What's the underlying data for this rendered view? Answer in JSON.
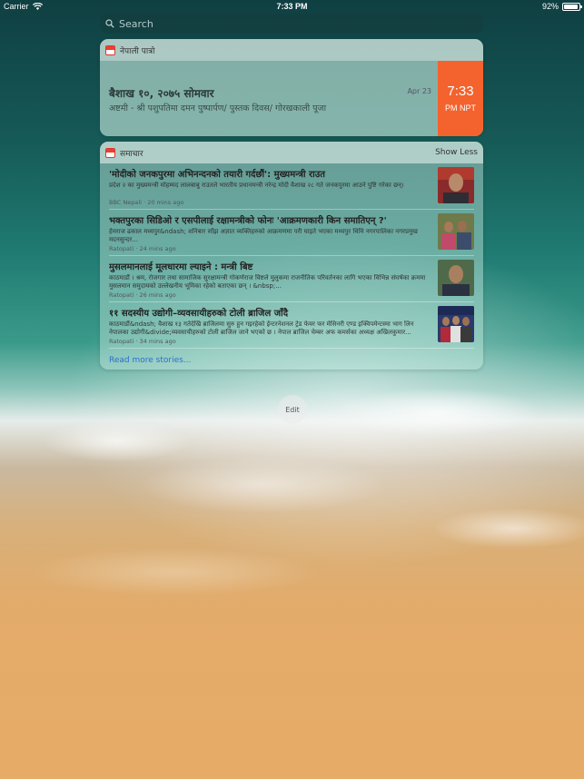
{
  "status_bar": {
    "carrier": "Carrier",
    "time": "7:33 PM",
    "battery": "92%",
    "battery_level": 0.92
  },
  "search": {
    "placeholder": "Search",
    "icon": "search-icon"
  },
  "calendar_widget": {
    "app_name": "नेपाली पात्रो",
    "title": "बैशाख १०, २०७५ सोमवार",
    "subtitle": "अष्टमी - श्री पशुपतिमा दमन पुष्पार्पण/ पुस्तक दिवस/ गोरखकाली पूजा",
    "date": "Apr 23",
    "time": "7:33",
    "time_zone": "PM NPT",
    "accent_color": "#f4622d"
  },
  "news_widget": {
    "app_name": "समाचार",
    "show_less": "Show Less",
    "items": [
      {
        "title": "'मोदीको जनकपुरमा अभिनन्दनको तयारी गर्दछौं': मुख्यमन्त्री राउत",
        "excerpt": "प्रदेश २ का मुख्यमन्त्री मोहम्मद लालबाबु राउतले भारतीय प्रधानमन्त्री नरेन्द्र मोदी वैशाख २८ गते जनकपुरमा आउने पुष्टि गरेका छन्।",
        "meta": "BBC Nepali · 20 mins ago"
      },
      {
        "title": "भक्तपुरका सिडिओ र एसपीलाई रक्षामन्त्रीको फोनः 'आक्रमणकारी किन समातिएन् ?'",
        "excerpt": "हेमराज ढकाल मध्यपुर&ndash; शनिबार साँझ अज्ञात व्यक्तिहरुको आक्रमणमा परी घाइते भएका मध्यपुर थिमि नगरपालिका नगरप्रमुख मदनसुन्दर...",
        "meta": "Ratopati · 24 mins ago"
      },
      {
        "title": "मुसलमानलाई मूलधारमा ल्याइने : मन्त्री बिष्ट",
        "excerpt": "काठमाडौं । श्रम, रोजगार तथा सामाजिक सुरक्षामन्त्री गोकर्णराज विष्टले मुलुकमा राजनीतिक परिवर्तनका लागि भएका विभिन्न संघर्षका क्रममा मुसलमान समुदायको उल्लेखनीय भूमिका रहेको बताएका छन् । &nbsp;...",
        "meta": "Ratopati · 26 mins ago"
      },
      {
        "title": "११ सदस्यीय उद्योगी–व्यवसायीहरुको टोली ब्राजिल जाँदै",
        "excerpt": "काठमाडौं&ndash; वैशाख १३ गतेदेखि ब्राजिलमा सुरु हुन गइरहेको ईन्टरनेशनल ट्रेड फेयर फर मेसिनरी एण्ड इक्विपमेन्टस्मा भाग लिन नेपालका उद्योगी&divide;व्यवसायीहरुको टोली ब्राजिल जाने भएको छ । नेपाल ब्राजिल चेम्बर अफ कमर्सका अध्यक्ष अखिलकुमार...",
        "meta": "Ratopati · 34 mins ago"
      }
    ],
    "read_more": "Read more stories..."
  },
  "edit_button": {
    "label": "Edit"
  }
}
